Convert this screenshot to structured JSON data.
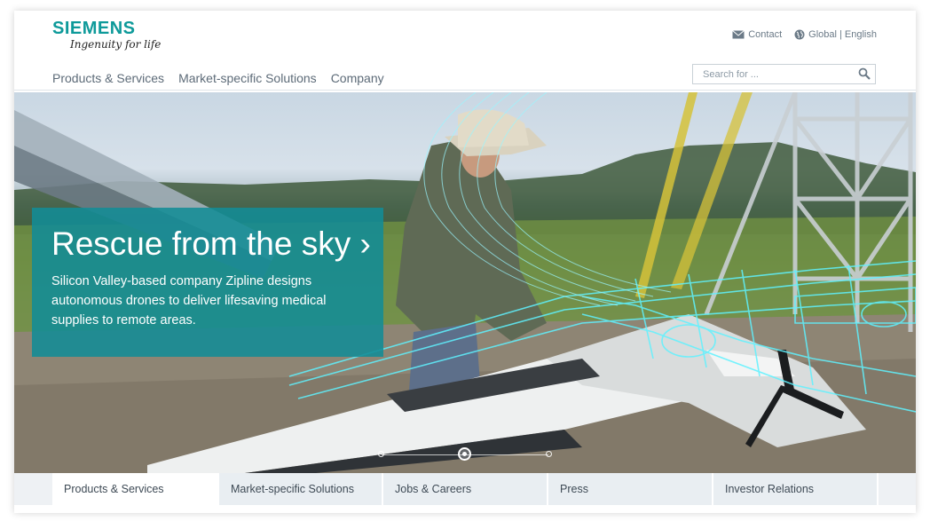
{
  "brand": {
    "name": "SIEMENS",
    "tagline": "Ingenuity for life"
  },
  "utility": {
    "contact": "Contact",
    "region": "Global | English"
  },
  "main_nav": [
    {
      "label": "Products & Services"
    },
    {
      "label": "Market-specific Solutions"
    },
    {
      "label": "Company"
    }
  ],
  "search": {
    "placeholder": "Search for ..."
  },
  "hero": {
    "title": "Rescue from the sky",
    "arrow": "›",
    "description": "Silicon Valley-based company Zipline designs autonomous drones to deliver lifesaving medical supplies to remote areas.",
    "slides_total": 3,
    "active_slide": 2
  },
  "bottom_tabs": [
    {
      "label": "Products & Services",
      "active": true
    },
    {
      "label": "Market-specific Solutions",
      "active": false
    },
    {
      "label": "Jobs & Careers",
      "active": false
    },
    {
      "label": "Press",
      "active": false
    },
    {
      "label": "Investor Relations",
      "active": false
    }
  ],
  "colors": {
    "brand_teal": "#0e9a9a",
    "caption_bg": "#128c96",
    "nav_text": "#5d6b78"
  },
  "icons": {
    "contact": "envelope-icon",
    "region": "globe-icon",
    "search": "magnifier-icon"
  }
}
